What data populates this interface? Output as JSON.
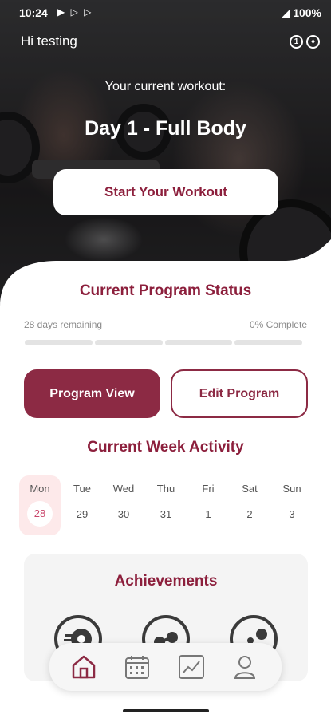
{
  "status_bar": {
    "time": "10:24",
    "right_text": "100%"
  },
  "header": {
    "greeting": "Hi testing"
  },
  "hero": {
    "current_label": "Your current workout:",
    "workout_title": "Day 1 - Full Body",
    "start_button": "Start Your Workout"
  },
  "program_status": {
    "title": "Current Program Status",
    "days_remaining": "28 days remaining",
    "complete": "0% Complete",
    "progress_percent": 0,
    "segments": 4
  },
  "actions": {
    "program_view": "Program View",
    "edit_program": "Edit Program"
  },
  "week": {
    "title": "Current Week Activity",
    "days": [
      {
        "name": "Mon",
        "num": "28"
      },
      {
        "name": "Tue",
        "num": "29"
      },
      {
        "name": "Wed",
        "num": "30"
      },
      {
        "name": "Thu",
        "num": "31"
      },
      {
        "name": "Fri",
        "num": "1"
      },
      {
        "name": "Sat",
        "num": "2"
      },
      {
        "name": "Sun",
        "num": "3"
      }
    ]
  },
  "achievements": {
    "title": "Achievements",
    "badges": [
      "weight-plate-icon",
      "dumbbell-icon",
      "barbell-icon"
    ]
  },
  "tabbar": {
    "items": [
      "home-icon",
      "calendar-icon",
      "chart-icon",
      "profile-icon"
    ]
  },
  "colors": {
    "brand": "#8c2a44",
    "today_bg": "#fde9ea"
  }
}
